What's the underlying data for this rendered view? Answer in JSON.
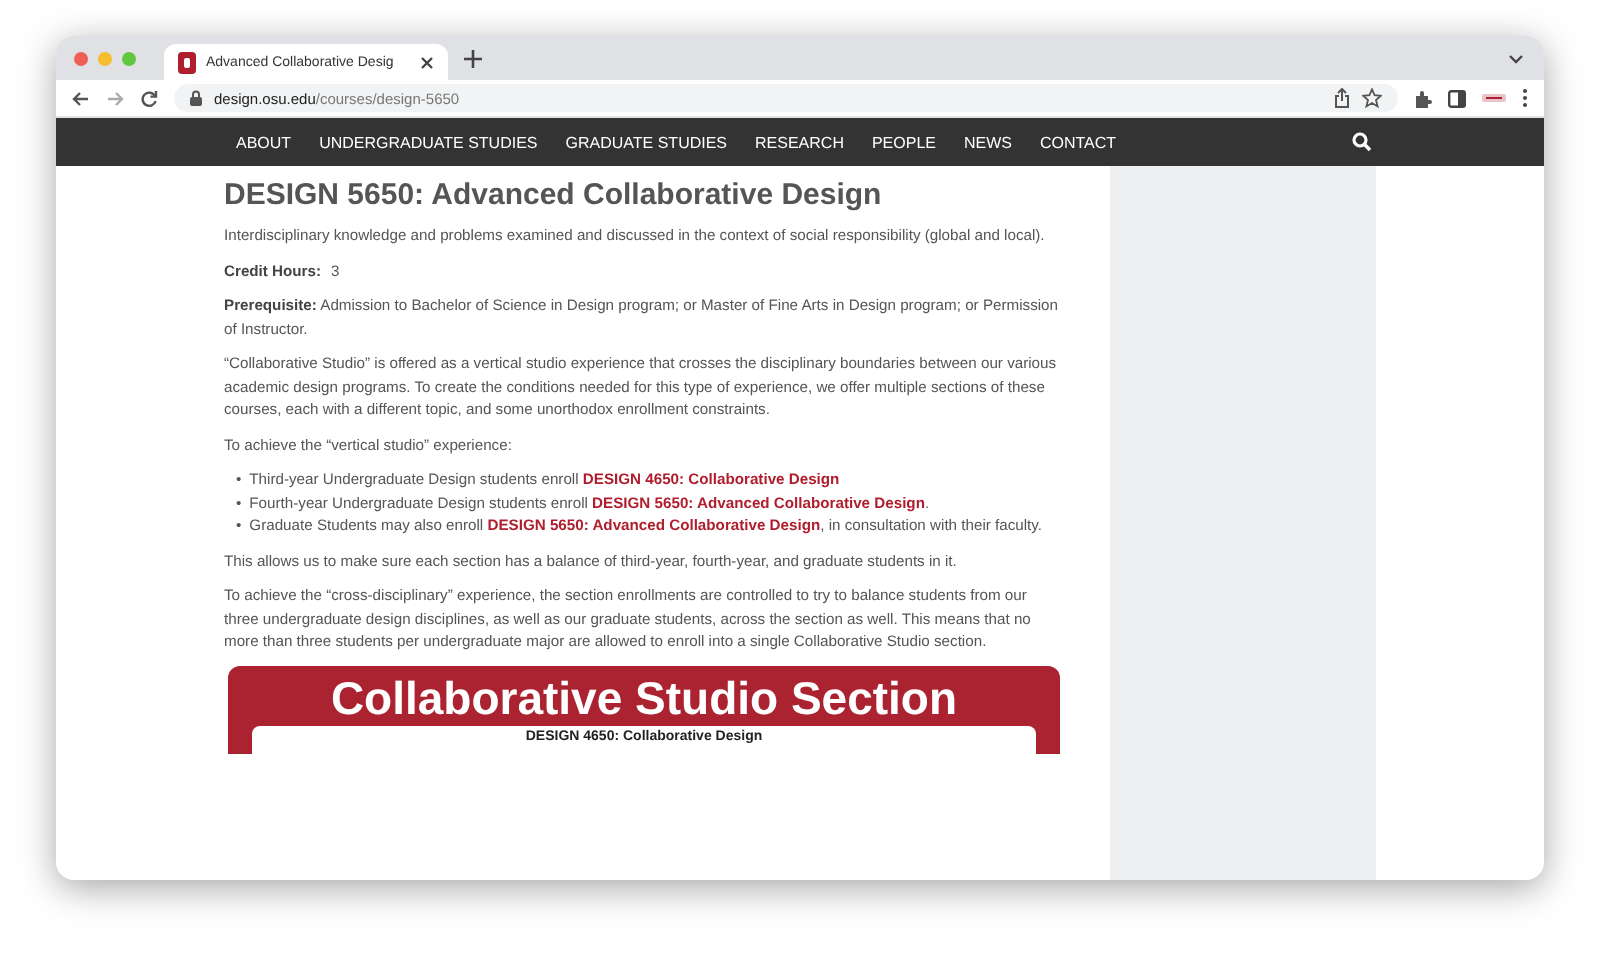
{
  "browser": {
    "tab": {
      "title": "Advanced Collaborative Desig",
      "selected": true
    },
    "address": {
      "domain": "design.osu.edu",
      "path": "/courses/design-5650"
    }
  },
  "nav": {
    "items": [
      "ABOUT",
      "UNDERGRADUATE STUDIES",
      "GRADUATE STUDIES",
      "RESEARCH",
      "PEOPLE",
      "NEWS",
      "CONTACT"
    ]
  },
  "content": {
    "heading": "DESIGN 5650: Advanced Collaborative Design",
    "description": "Interdisciplinary knowledge and problems examined and discussed in the context of social responsibility (global and local).",
    "credit_hours": {
      "label": "Credit Hours:",
      "value": "3"
    },
    "prerequisite": "**Prerequisite:** Admission to Bachelor of Science in Design program; or Master of Fine Arts in Design program; or Permission of Instructor.",
    "intro": "“Collaborative Studio” is offered as a vertical studio experience that crosses the disciplinary boundaries between our various academic design programs. To create the conditions needed for this type of experience, we offer multiple sections of these courses, each with a different topic, and some unorthodox enrollment constraints.",
    "list_intro": "To achieve the “vertical studio” experience:",
    "bullets": [
      {
        "marker": "•",
        "before": "Third-year Undergraduate Design students enroll",
        "link": "DESIGN 4650: Collaborative Design"
      },
      {
        "marker": "•",
        "before": "Fourth-year Undergraduate Design students enroll",
        "link": "DESIGN 5650: Advanced Collaborative Design",
        "after": "."
      },
      {
        "marker": "•",
        "before": "Graduate Students may also enroll",
        "link": "DESIGN 5650: Advanced Collaborative Design",
        "after": ", in consultation with their faculty."
      }
    ],
    "balance": "This allows us to make sure each section has a balance of third-year, fourth-year, and graduate students in it.",
    "cross": "To achieve the “cross-disciplinary” experience, the section enrollments are controlled to try to balance students from our three undergraduate design disciplines, as well as our graduate students, across the section as well. This means that no more than three students per undergraduate major are allowed to enroll into a single Collaborative Studio section.",
    "graphic": {
      "title": "Collaborative Studio Section",
      "subtitle": "DESIGN 4650: Collaborative Design"
    }
  }
}
